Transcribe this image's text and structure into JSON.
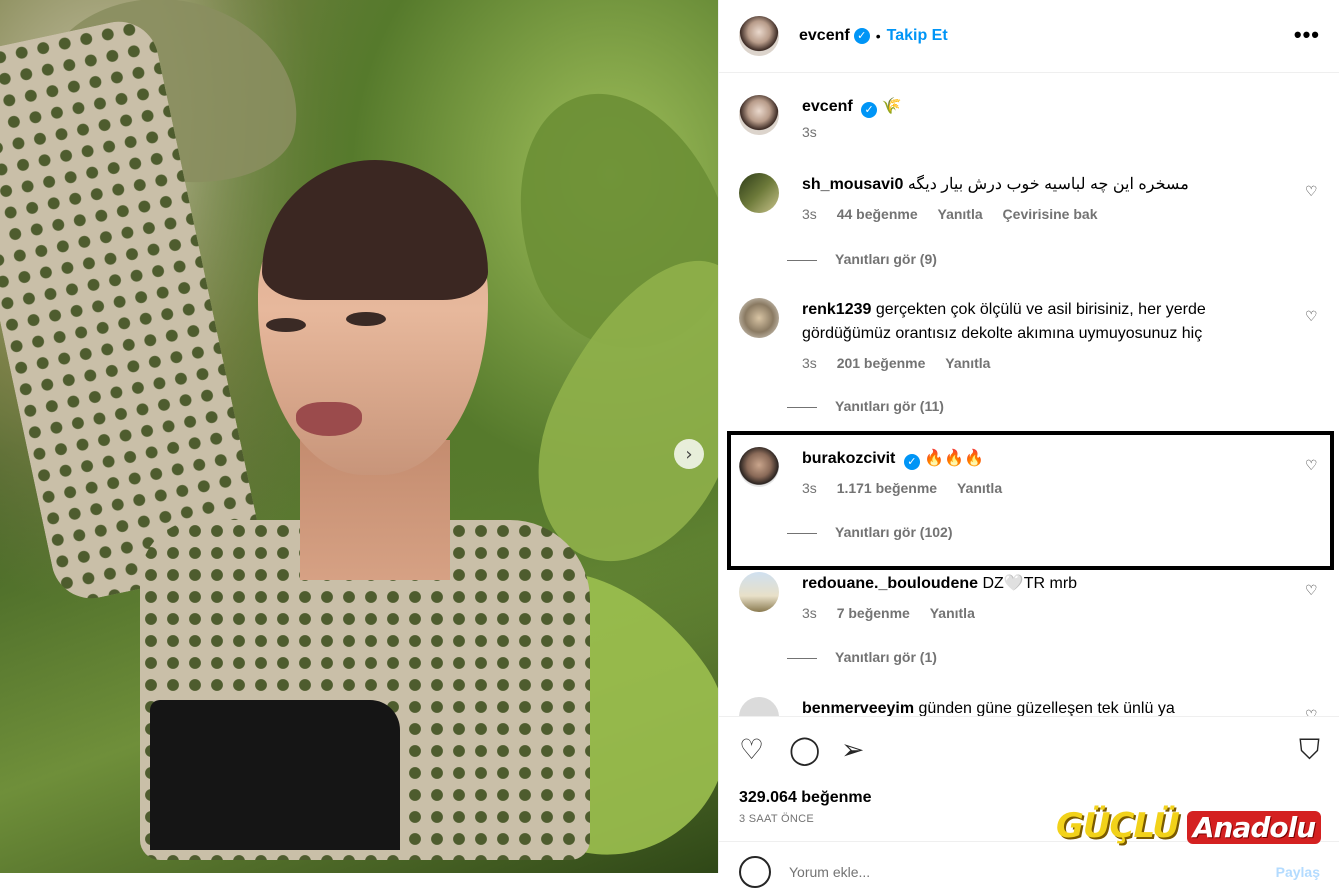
{
  "post": {
    "username": "evcenf",
    "follow_label": "Takip Et",
    "separator": "•",
    "more_label": "•••",
    "caption_time": "3s",
    "caption_emoji": "🌾"
  },
  "comments": [
    {
      "username": "sh_mousavi0",
      "text": "مسخره این چه لباسیه خوب درش بیار دیگه",
      "time": "3s",
      "likes": "44 beğenme",
      "reply": "Yanıtla",
      "translate": "Çevirisine bak",
      "view_replies": "Yanıtları gör (9)"
    },
    {
      "username": "renk1239",
      "text": "gerçekten çok ölçülü ve asil birisiniz, her yerde gördüğümüz orantısız dekolte akımına uymuyosunuz hiç",
      "time": "3s",
      "likes": "201 beğenme",
      "reply": "Yanıtla",
      "view_replies": "Yanıtları gör (11)"
    },
    {
      "username": "burakozcivit",
      "text": "🔥🔥🔥",
      "time": "3s",
      "likes": "1.171 beğenme",
      "reply": "Yanıtla",
      "view_replies": "Yanıtları gör (102)"
    },
    {
      "username": "redouane._bouloudene",
      "text": "DZ🤍TR mrb",
      "time": "3s",
      "likes": "7 beğenme",
      "reply": "Yanıtla",
      "view_replies": "Yanıtları gör (1)"
    },
    {
      "username": "benmerveeyim",
      "text": "günden güne güzelleşen tek ünlü ya"
    }
  ],
  "footer": {
    "likes_count": "329.064 beğenme",
    "time_ago": "3 SAAT ÖNCE",
    "comment_placeholder": "Yorum ekle...",
    "post_label": "Paylaş"
  },
  "watermark": {
    "part1": "GÜÇLÜ",
    "part2": "Anadolu"
  },
  "colors": {
    "accent": "#0095f6",
    "muted": "#737373",
    "highlight_border": "#000000"
  }
}
